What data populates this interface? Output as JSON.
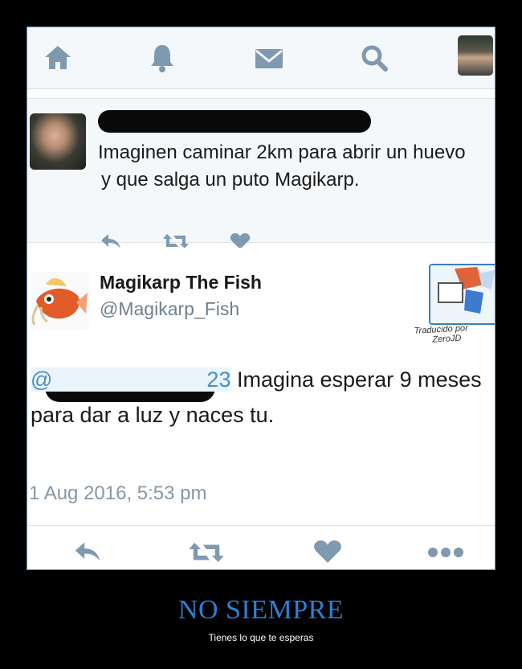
{
  "colors": {
    "accent": "#4a8fc6",
    "icon": "#7f99b0",
    "caption_title": "#2d7fd5"
  },
  "navbar": {
    "icons": [
      "home-icon",
      "bell-icon",
      "mail-icon",
      "search-icon"
    ]
  },
  "tweet1": {
    "text_line1": "Imaginen caminar 2km para abrir un huevo",
    "text_line2": "y que salga un puto Magikarp.",
    "actions": [
      "reply-icon",
      "retweet-icon",
      "heart-icon"
    ]
  },
  "tweet2": {
    "name": "Magikarp The Fish",
    "handle": "@Magikarp_Fish",
    "signature_line1": "Traducido por",
    "signature_line2": "ZeroJD",
    "mention_visible": "@",
    "mention_suffix": "23",
    "text_part1": " Imagina esperar 9 meses",
    "text_part2": "para dar a luz y naces tu.",
    "timestamp": "1 Aug 2016, 5:53 pm",
    "actions": [
      "reply-icon",
      "retweet-icon",
      "heart-icon",
      "more-icon"
    ]
  },
  "caption": {
    "title": "NO SIEMPRE",
    "subtitle": "Tienes lo que te esperas"
  }
}
